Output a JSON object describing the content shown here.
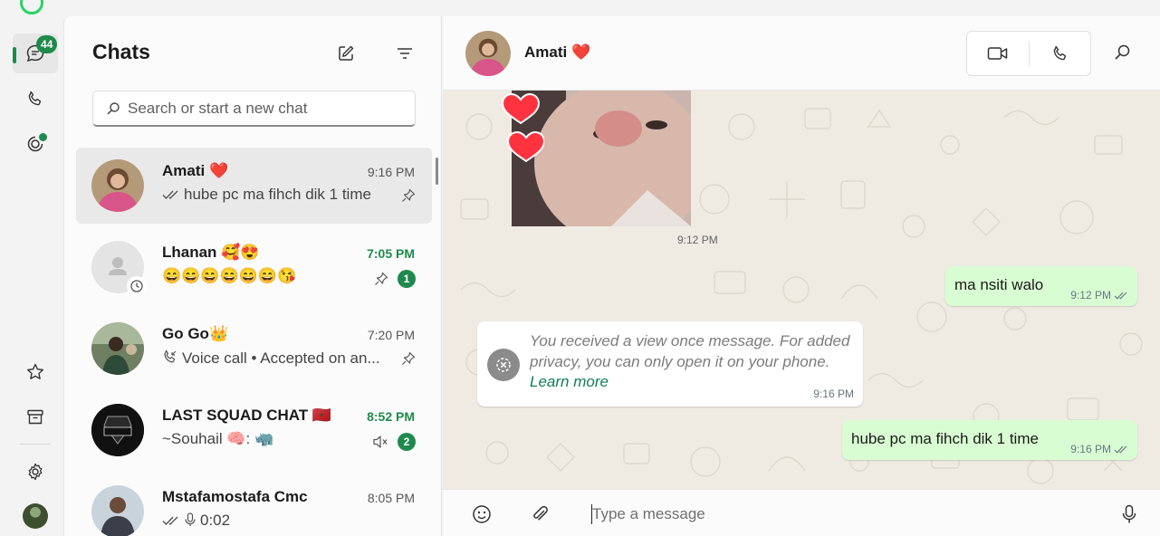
{
  "app": {
    "logo_icon": "whatsapp-logo-icon",
    "accent": "#1f8a4c"
  },
  "rail": {
    "chats_badge": "44",
    "items": [
      {
        "name": "chats",
        "icon": "chat-icon"
      },
      {
        "name": "calls",
        "icon": "phone-icon"
      },
      {
        "name": "status",
        "icon": "status-icon"
      },
      {
        "name": "starred",
        "icon": "star-icon"
      },
      {
        "name": "archived",
        "icon": "archive-icon"
      },
      {
        "name": "settings",
        "icon": "gear-icon"
      }
    ]
  },
  "list": {
    "title": "Chats",
    "search_placeholder": "Search or start a new chat",
    "chats": [
      {
        "name": "Amati ❤️",
        "time": "9:16 PM",
        "preview": "hube pc ma fihch dik 1 time",
        "pinned": true,
        "unread": null
      },
      {
        "name": "Lhanan 🥰😍",
        "time": "7:05 PM",
        "preview": "😄😄😄😄😄😄😘",
        "pinned": true,
        "unread": "1"
      },
      {
        "name": "Go Go👑",
        "time": "7:20 PM",
        "preview": "Voice call • Accepted on an...",
        "pinned": true,
        "unread": null
      },
      {
        "name": "LAST SQUAD CHAT 🇲🇦",
        "time": "8:52 PM",
        "preview": "~Souhail 🧠: 🦏",
        "muted": true,
        "unread": "2"
      },
      {
        "name": "Mstafamostafa Cmc",
        "time": "8:05 PM",
        "preview": "0:02",
        "unread": null
      }
    ]
  },
  "conversation": {
    "contact_name": "Amati ❤️",
    "media_time": "9:12 PM",
    "messages": [
      {
        "text": "ma nsiti walo",
        "time": "9:12 PM"
      },
      {
        "view_once_text": "You received a view once message. For added privacy, you can only open it on your phone.",
        "link": "Learn more",
        "time": "9:16 PM"
      },
      {
        "text": "hube pc ma fihch dik 1 time",
        "time": "9:16 PM"
      }
    ],
    "composer_placeholder": "Type a message"
  }
}
